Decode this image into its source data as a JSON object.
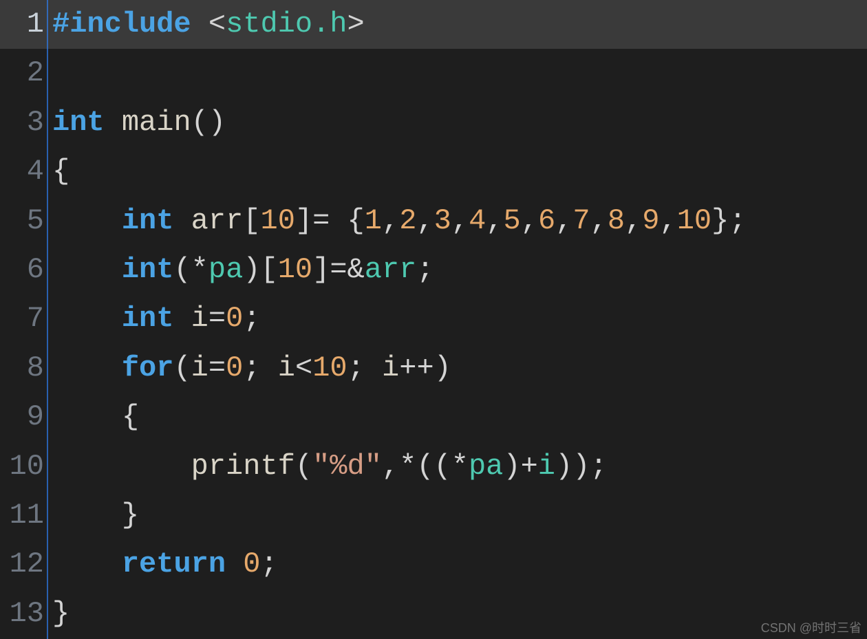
{
  "editor": {
    "highlighted_line": 1,
    "lines": [
      {
        "n": 1,
        "tokens": [
          {
            "t": "#include ",
            "c": "pre"
          },
          {
            "t": "<",
            "c": "punc"
          },
          {
            "t": "stdio.h",
            "c": "hdr"
          },
          {
            "t": ">",
            "c": "punc"
          }
        ]
      },
      {
        "n": 2,
        "tokens": []
      },
      {
        "n": 3,
        "tokens": [
          {
            "t": "int",
            "c": "kw"
          },
          {
            "t": " ",
            "c": "punc"
          },
          {
            "t": "main",
            "c": "fn"
          },
          {
            "t": "()",
            "c": "punc"
          }
        ]
      },
      {
        "n": 4,
        "tokens": [
          {
            "t": "{",
            "c": "punc"
          }
        ]
      },
      {
        "n": 5,
        "tokens": [
          {
            "t": "    ",
            "c": "punc"
          },
          {
            "t": "int",
            "c": "kw"
          },
          {
            "t": " ",
            "c": "punc"
          },
          {
            "t": "arr",
            "c": "id"
          },
          {
            "t": "[",
            "c": "punc"
          },
          {
            "t": "10",
            "c": "num"
          },
          {
            "t": "]= {",
            "c": "punc"
          },
          {
            "t": "1",
            "c": "num"
          },
          {
            "t": ",",
            "c": "punc"
          },
          {
            "t": "2",
            "c": "num"
          },
          {
            "t": ",",
            "c": "punc"
          },
          {
            "t": "3",
            "c": "num"
          },
          {
            "t": ",",
            "c": "punc"
          },
          {
            "t": "4",
            "c": "num"
          },
          {
            "t": ",",
            "c": "punc"
          },
          {
            "t": "5",
            "c": "num"
          },
          {
            "t": ",",
            "c": "punc"
          },
          {
            "t": "6",
            "c": "num"
          },
          {
            "t": ",",
            "c": "punc"
          },
          {
            "t": "7",
            "c": "num"
          },
          {
            "t": ",",
            "c": "punc"
          },
          {
            "t": "8",
            "c": "num"
          },
          {
            "t": ",",
            "c": "punc"
          },
          {
            "t": "9",
            "c": "num"
          },
          {
            "t": ",",
            "c": "punc"
          },
          {
            "t": "10",
            "c": "num"
          },
          {
            "t": "};",
            "c": "punc"
          }
        ]
      },
      {
        "n": 6,
        "tokens": [
          {
            "t": "    ",
            "c": "punc"
          },
          {
            "t": "int",
            "c": "kw"
          },
          {
            "t": "(*",
            "c": "punc"
          },
          {
            "t": "pa",
            "c": "var"
          },
          {
            "t": ")[",
            "c": "punc"
          },
          {
            "t": "10",
            "c": "num"
          },
          {
            "t": "]=&",
            "c": "punc"
          },
          {
            "t": "arr",
            "c": "var"
          },
          {
            "t": ";",
            "c": "punc"
          }
        ]
      },
      {
        "n": 7,
        "tokens": [
          {
            "t": "    ",
            "c": "punc"
          },
          {
            "t": "int",
            "c": "kw"
          },
          {
            "t": " ",
            "c": "punc"
          },
          {
            "t": "i",
            "c": "id"
          },
          {
            "t": "=",
            "c": "punc"
          },
          {
            "t": "0",
            "c": "num"
          },
          {
            "t": ";",
            "c": "punc"
          }
        ]
      },
      {
        "n": 8,
        "tokens": [
          {
            "t": "    ",
            "c": "punc"
          },
          {
            "t": "for",
            "c": "kw"
          },
          {
            "t": "(",
            "c": "punc"
          },
          {
            "t": "i",
            "c": "id"
          },
          {
            "t": "=",
            "c": "punc"
          },
          {
            "t": "0",
            "c": "num"
          },
          {
            "t": "; ",
            "c": "punc"
          },
          {
            "t": "i",
            "c": "id"
          },
          {
            "t": "<",
            "c": "punc"
          },
          {
            "t": "10",
            "c": "num"
          },
          {
            "t": "; ",
            "c": "punc"
          },
          {
            "t": "i",
            "c": "id"
          },
          {
            "t": "++)",
            "c": "punc"
          }
        ]
      },
      {
        "n": 9,
        "tokens": [
          {
            "t": "    {",
            "c": "punc"
          }
        ]
      },
      {
        "n": 10,
        "tokens": [
          {
            "t": "        ",
            "c": "punc"
          },
          {
            "t": "printf",
            "c": "fn"
          },
          {
            "t": "(",
            "c": "punc"
          },
          {
            "t": "\"%d\"",
            "c": "str"
          },
          {
            "t": ",*((*",
            "c": "punc"
          },
          {
            "t": "pa",
            "c": "var"
          },
          {
            "t": ")+",
            "c": "punc"
          },
          {
            "t": "i",
            "c": "var"
          },
          {
            "t": "));",
            "c": "punc"
          }
        ]
      },
      {
        "n": 11,
        "tokens": [
          {
            "t": "    }",
            "c": "punc"
          }
        ]
      },
      {
        "n": 12,
        "tokens": [
          {
            "t": "    ",
            "c": "punc"
          },
          {
            "t": "return",
            "c": "kw"
          },
          {
            "t": " ",
            "c": "punc"
          },
          {
            "t": "0",
            "c": "num"
          },
          {
            "t": ";",
            "c": "punc"
          }
        ]
      },
      {
        "n": 13,
        "tokens": [
          {
            "t": "}",
            "c": "punc"
          }
        ]
      }
    ]
  },
  "watermark": "CSDN @时时三省"
}
